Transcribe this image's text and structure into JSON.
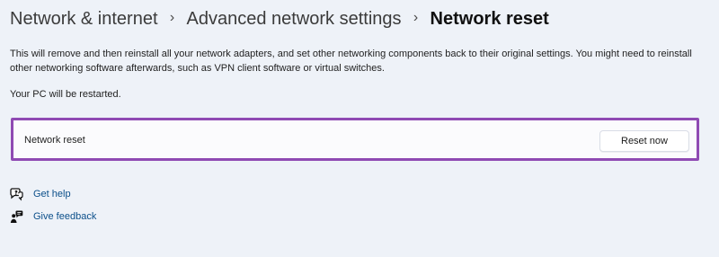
{
  "header": {
    "breadcrumb": [
      {
        "label": "Network & internet"
      },
      {
        "label": "Advanced network settings"
      },
      {
        "label": "Network reset"
      }
    ],
    "separator": "›"
  },
  "content": {
    "description": "This will remove and then reinstall all your network adapters, and set other networking components back to their original settings. You might need to reinstall other networking software afterwards, such as VPN client software or virtual switches.",
    "restart_note": "Your PC will be restarted."
  },
  "reset_card": {
    "label": "Network reset",
    "button_label": "Reset now",
    "highlight_color": "#8f4ab3"
  },
  "help_links": [
    {
      "label": "Get help",
      "icon": "chat-help-icon"
    },
    {
      "label": "Give feedback",
      "icon": "feedback-person-icon"
    }
  ]
}
